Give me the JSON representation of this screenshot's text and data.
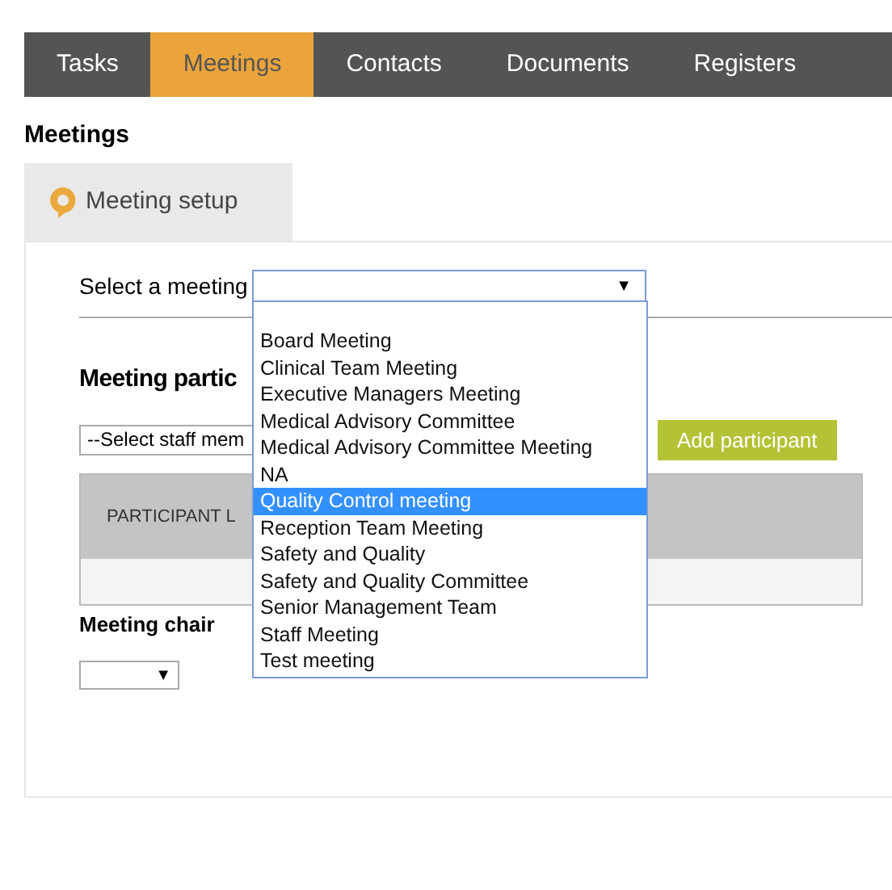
{
  "nav_tabs": [
    {
      "label": "Tasks",
      "selected": false
    },
    {
      "label": "Meetings",
      "selected": true
    },
    {
      "label": "Contacts",
      "selected": false
    },
    {
      "label": "Documents",
      "selected": false
    },
    {
      "label": "Registers",
      "selected": false
    }
  ],
  "page_title": "Meetings",
  "section_tab": {
    "label": "Meeting setup"
  },
  "meeting_select": {
    "label": "Select a meeting",
    "arrow": "▼",
    "expanded": true,
    "options": [
      {
        "label": "Board Meeting",
        "selected": false
      },
      {
        "label": "Clinical Team Meeting",
        "selected": false
      },
      {
        "label": "Executive Managers Meeting",
        "selected": false
      },
      {
        "label": "Medical Advisory Committee",
        "selected": false
      },
      {
        "label": "Medical Advisory Committee Meeting",
        "selected": false
      },
      {
        "label": "NA",
        "selected": false
      },
      {
        "label": "Quality Control meeting",
        "selected": true
      },
      {
        "label": "Reception Team Meeting",
        "selected": false
      },
      {
        "label": "Safety and Quality",
        "selected": false
      },
      {
        "label": "Safety and Quality Committee",
        "selected": false
      },
      {
        "label": "Senior Management Team",
        "selected": false
      },
      {
        "label": "Staff Meeting",
        "selected": false
      },
      {
        "label": "Test meeting",
        "selected": false
      }
    ]
  },
  "participants": {
    "heading": "Meeting partic",
    "staff_select": "--Select staff mem",
    "add_button": "Add participant",
    "table_header": "PARTICIPANT L"
  },
  "chair": {
    "label": "Meeting chair",
    "arrow": "▼"
  }
}
